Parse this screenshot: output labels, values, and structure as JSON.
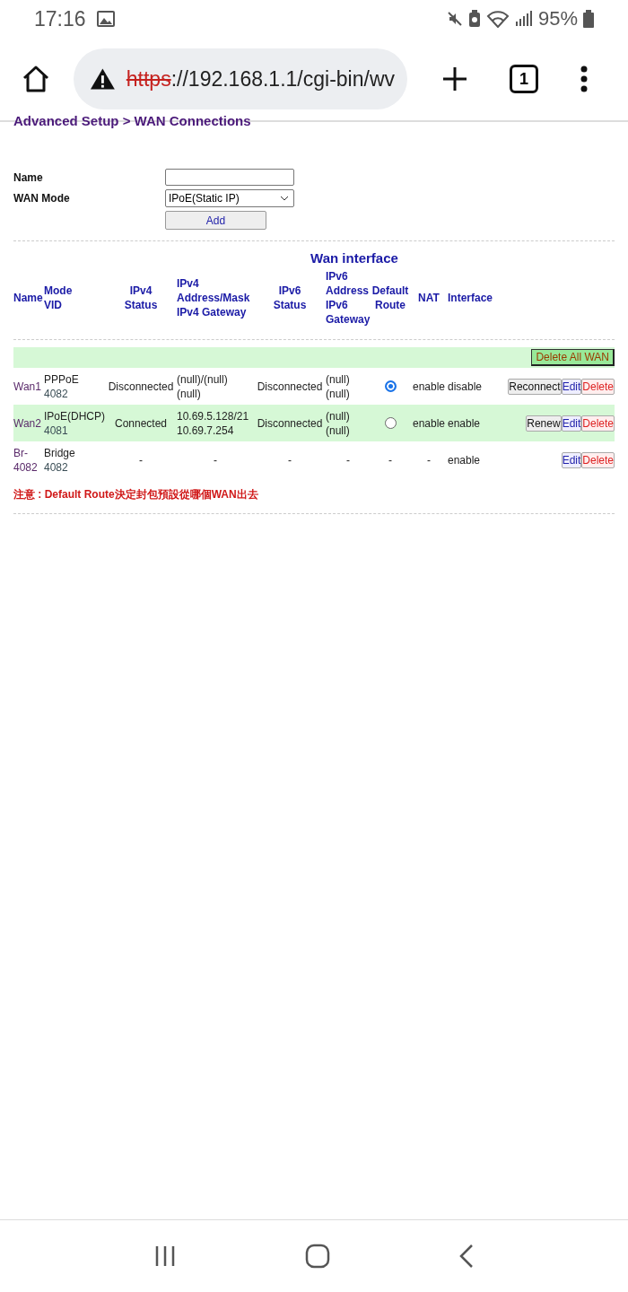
{
  "status_bar": {
    "time": "17:16",
    "battery": "95%"
  },
  "browser": {
    "url_scheme": "https",
    "url_rest": "://192.168.1.1/cgi-bin/wv",
    "tab_count": "1"
  },
  "breadcrumb": "Advanced Setup > WAN Connections",
  "form": {
    "name_label": "Name",
    "mode_label": "WAN Mode",
    "mode_value": "IPoE(Static IP)",
    "add_button": "Add"
  },
  "table": {
    "title": "Wan interface",
    "columns": [
      [
        "Name"
      ],
      [
        "Mode",
        "VID"
      ],
      [
        "IPv4",
        "Status"
      ],
      [
        "IPv4",
        "Address/Mask",
        "IPv4 Gateway"
      ],
      [
        "IPv6",
        "Status"
      ],
      [
        "IPv6",
        "Address",
        "IPv6",
        "Gateway"
      ],
      [
        "Default",
        "Route"
      ],
      [
        "NAT"
      ],
      [
        "Interface"
      ]
    ],
    "delete_all_button": "Delete All WAN",
    "rows": [
      {
        "name": "Wan1",
        "mode": "PPPoE",
        "vid": "4082",
        "ipv4_status": "Disconnected",
        "ipv4_address": "(null)/(null)",
        "ipv4_gateway": "(null)",
        "ipv6_status": "Disconnected",
        "ipv6_address": "(null)",
        "ipv6_gateway": "(null)",
        "default_route": {
          "kind": "radio",
          "selected": true
        },
        "nat": "enable",
        "interface": "disable",
        "highlighted": false,
        "buttons": [
          {
            "label": "Reconnect",
            "kind": "action"
          },
          {
            "label": "Edit",
            "kind": "edit"
          },
          {
            "label": "Delete",
            "kind": "delete"
          }
        ]
      },
      {
        "name": "Wan2",
        "mode": "IPoE(DHCP)",
        "vid": "4081",
        "ipv4_status": "Connected",
        "ipv4_address": "10.69.5.128/21",
        "ipv4_gateway": "10.69.7.254",
        "ipv6_status": "Disconnected",
        "ipv6_address": "(null)",
        "ipv6_gateway": "(null)",
        "default_route": {
          "kind": "radio",
          "selected": false
        },
        "nat": "enable",
        "interface": "enable",
        "highlighted": true,
        "buttons": [
          {
            "label": "Renew",
            "kind": "action"
          },
          {
            "label": "Edit",
            "kind": "edit"
          },
          {
            "label": "Delete",
            "kind": "delete"
          }
        ]
      },
      {
        "name": "Br-4082",
        "mode": "Bridge",
        "vid": "4082",
        "ipv4_status": "-",
        "ipv4_address": "-",
        "ipv6_status": "-",
        "ipv6_address": "-",
        "default_route": {
          "kind": "text",
          "text": "-"
        },
        "nat": "-",
        "interface": "enable",
        "highlighted": false,
        "buttons": [
          {
            "label": "Edit",
            "kind": "edit"
          },
          {
            "label": "Delete",
            "kind": "delete"
          }
        ]
      }
    ],
    "note": "注意 : Default Route決定封包預設從哪個WAN出去"
  }
}
